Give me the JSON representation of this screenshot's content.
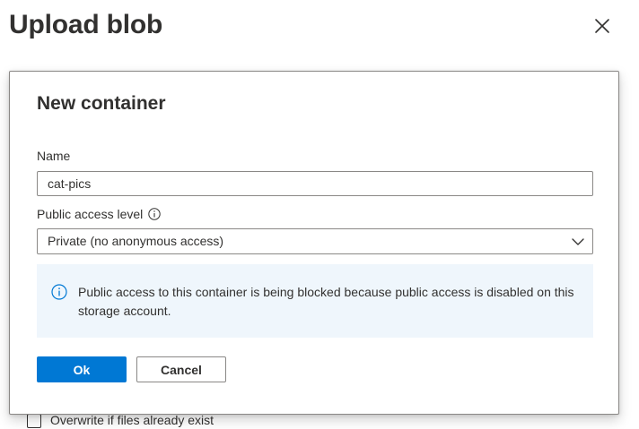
{
  "panel": {
    "title": "Upload blob",
    "close_icon": "close-icon"
  },
  "background": {
    "overwrite_label": "Overwrite if files already exist"
  },
  "dialog": {
    "title": "New container",
    "name_label": "Name",
    "name_value": "cat-pics",
    "access_label": "Public access level",
    "access_info_icon": "info-icon",
    "access_value": "Private (no anonymous access)",
    "dropdown_icon": "chevron-down-icon",
    "info_message": "Public access to this container is being blocked because public access is disabled on this storage account.",
    "info_icon": "info-icon",
    "ok_label": "Ok",
    "cancel_label": "Cancel"
  },
  "colors": {
    "primary": "#0078d4",
    "info_background": "#eff6fc",
    "text": "#323130",
    "border": "#8a8886"
  }
}
